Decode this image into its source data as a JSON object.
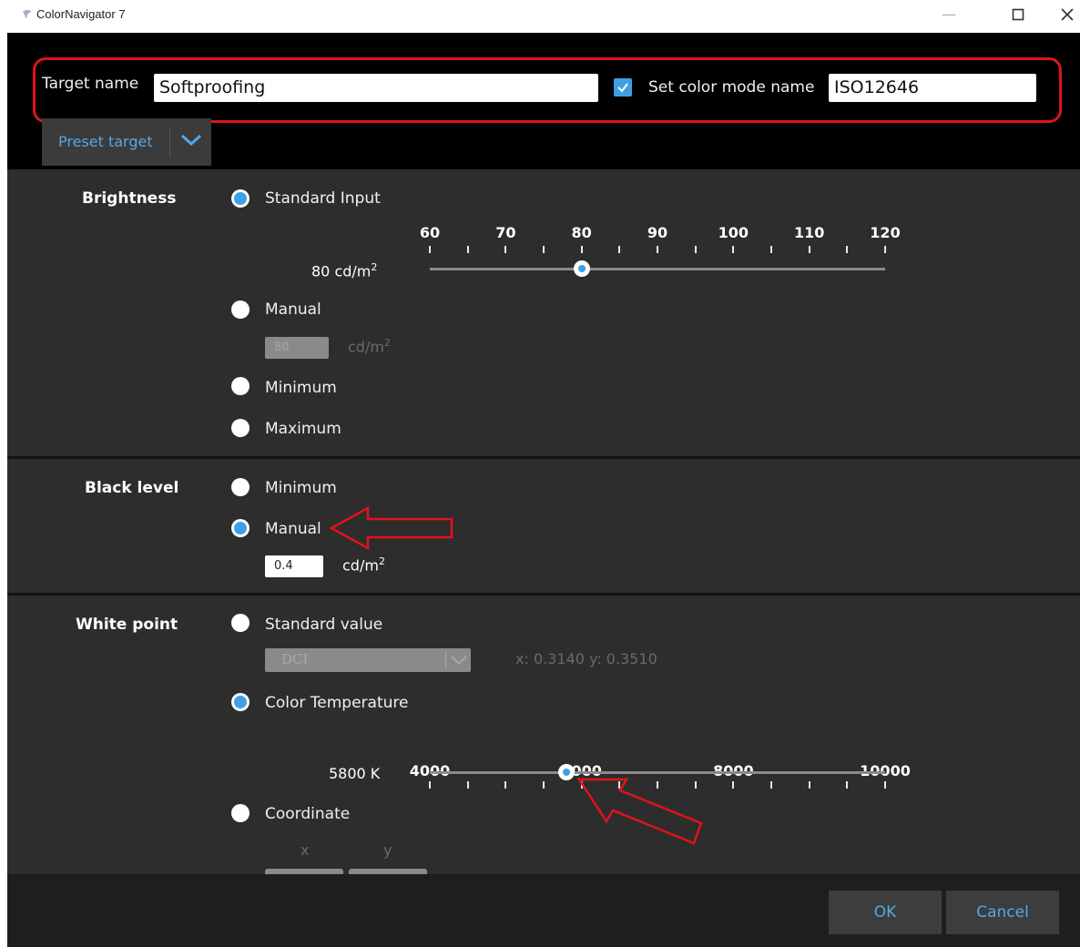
{
  "window": {
    "title": "ColorNavigator 7"
  },
  "header": {
    "target_name_label": "Target name",
    "target_name_value": "Softproofing",
    "set_color_mode_checked": true,
    "set_color_mode_label": "Set color mode name",
    "color_mode_name_value": "ISO12646",
    "preset_target_label": "Preset target"
  },
  "brightness": {
    "title": "Brightness",
    "options": {
      "standard_input": "Standard Input",
      "manual": "Manual",
      "minimum": "Minimum",
      "maximum": "Maximum"
    },
    "selected": "standard_input",
    "slider": {
      "ticks": [
        "60",
        "70",
        "80",
        "90",
        "100",
        "110",
        "120"
      ],
      "min": 60,
      "max": 120,
      "value": 80,
      "value_label": "80 cd/m",
      "unit_sup": "2"
    },
    "manual_input": {
      "value": "80",
      "unit": "cd/m",
      "unit_sup": "2"
    }
  },
  "black_level": {
    "title": "Black level",
    "options": {
      "minimum": "Minimum",
      "manual": "Manual"
    },
    "selected": "manual",
    "manual_input": {
      "value": "0.4",
      "unit": "cd/m",
      "unit_sup": "2"
    }
  },
  "white_point": {
    "title": "White point",
    "options": {
      "standard_value": "Standard value",
      "color_temperature": "Color Temperature",
      "coordinate": "Coordinate"
    },
    "selected": "color_temperature",
    "standard_select_value": "DCI",
    "standard_coords": "x: 0.3140  y: 0.3510",
    "slider": {
      "ticks": [
        "4000",
        "6000",
        "8000",
        "10000"
      ],
      "min": 4000,
      "max": 10000,
      "value": 5800,
      "value_label": "5800 K"
    },
    "coordinate_labels": {
      "x": "x",
      "y": "y"
    }
  },
  "footer": {
    "ok": "OK",
    "cancel": "Cancel"
  },
  "colors": {
    "accent": "#3ea0e3",
    "annotation": "#e1121b",
    "link_text": "#56a7e7"
  }
}
